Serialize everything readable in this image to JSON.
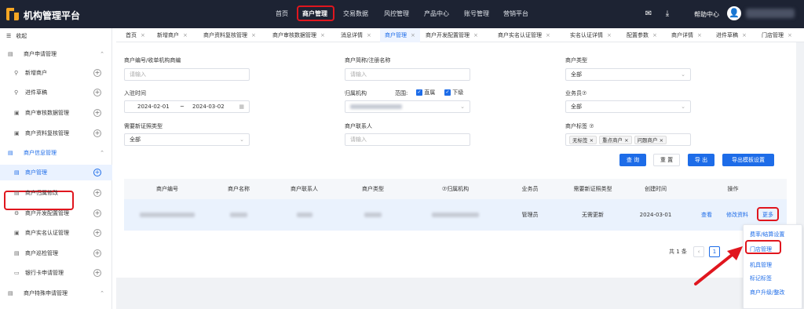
{
  "app": {
    "title": "机构管理平台"
  },
  "topnav": [
    {
      "label": "首页"
    },
    {
      "label": "商户管理"
    },
    {
      "label": "交易数据"
    },
    {
      "label": "风控管理"
    },
    {
      "label": "产品中心"
    },
    {
      "label": "账号管理"
    },
    {
      "label": "营销平台"
    }
  ],
  "header": {
    "help": "帮助中心",
    "mail_icon": "mail-icon",
    "download_icon": "download-icon",
    "avatar_icon": "user-icon"
  },
  "sidebar": {
    "collapse": "收起",
    "items": [
      {
        "label": "商户申请管理",
        "type": "group",
        "arrow": "^"
      },
      {
        "label": "新增商户",
        "type": "sub"
      },
      {
        "label": "进件草稿",
        "type": "sub"
      },
      {
        "label": "商户审核数据管理",
        "type": "sub"
      },
      {
        "label": "商户资料复核管理",
        "type": "sub"
      },
      {
        "label": "商户信息管理",
        "type": "group",
        "arrow": "^"
      },
      {
        "label": "商户管理",
        "type": "sub"
      },
      {
        "label": "商户归属修改",
        "type": "sub"
      },
      {
        "label": "商户开发配置管理",
        "type": "sub"
      },
      {
        "label": "商户实名认证管理",
        "type": "sub"
      },
      {
        "label": "商户巡检管理",
        "type": "sub"
      },
      {
        "label": "银行卡申请管理",
        "type": "sub"
      },
      {
        "label": "商户特殊申请管理",
        "type": "group",
        "arrow": "^"
      }
    ]
  },
  "tabs": [
    {
      "label": "首页"
    },
    {
      "label": "新增商户"
    },
    {
      "label": "商户资料复核管理"
    },
    {
      "label": "商户审核数据管理"
    },
    {
      "label": "消息详情"
    },
    {
      "label": "商户管理"
    },
    {
      "label": "商户开发配置管理"
    },
    {
      "label": "商户实名认证管理"
    },
    {
      "label": "实名认证详情"
    },
    {
      "label": "配置参数"
    },
    {
      "label": "商户详情"
    },
    {
      "label": "进件草稿"
    },
    {
      "label": "门店管理"
    }
  ],
  "filters": {
    "merchant_no": {
      "label": "商户编号/收单机构商编",
      "placeholder": "请输入"
    },
    "merchant_name": {
      "label": "商户简称/注册名称",
      "placeholder": "请输入"
    },
    "merchant_type": {
      "label": "商户类型",
      "value": "全部"
    },
    "entry_time": {
      "label": "入驻时间",
      "start": "2024-02-01",
      "sep": "~",
      "end": "2024-03-02"
    },
    "org": {
      "label": "归属机构",
      "scope_label": "范围:",
      "opt1": "直属",
      "opt2": "下级"
    },
    "salesman": {
      "label": "业务员⑦",
      "value": "全部"
    },
    "cert_type": {
      "label": "需要新证照类型",
      "value": "全部"
    },
    "contact": {
      "label": "商户联系人",
      "placeholder": "请输入"
    },
    "tags": {
      "label": "商户标签 ⑦",
      "chips": [
        "无标签",
        "重点商户",
        "问题商户"
      ]
    }
  },
  "buttons": {
    "query": "查 询",
    "reset": "重 置",
    "export": "导 出",
    "export_template": "导出模板设置"
  },
  "table": {
    "headers": [
      "商户编号",
      "商户名称",
      "商户联系人",
      "商户类型",
      "⑦归属机构",
      "业务员",
      "需要新证照类型",
      "创建时间",
      "操作"
    ],
    "row": {
      "salesman": "管理员",
      "cert": "无需更新",
      "created": "2024-03-01",
      "view": "查看",
      "edit": "修改资料",
      "more": "更多"
    }
  },
  "pager": {
    "total": "共 1 条",
    "page": "1"
  },
  "dropdown": [
    "费率/结算设置",
    "门店管理",
    "机具管理",
    "标记标签",
    "商户升级/整改"
  ],
  "colors": {
    "brand": "#1d6ce8",
    "topbar": "#1d2333",
    "highlight": "#e0161e"
  }
}
